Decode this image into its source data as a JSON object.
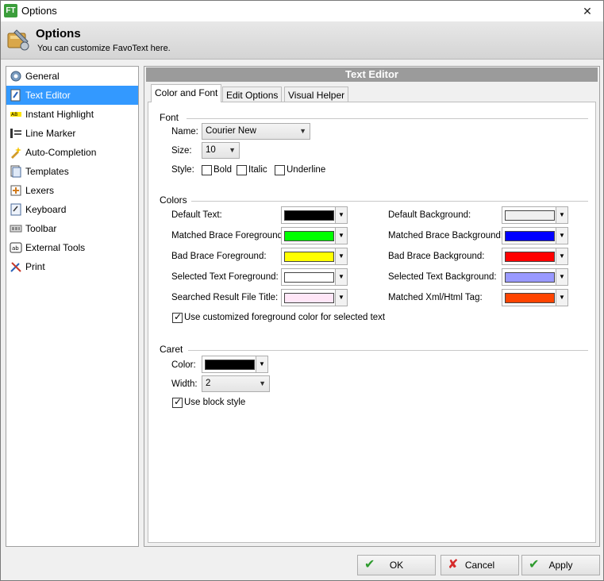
{
  "window": {
    "title": "Options",
    "app_badge": "FT",
    "close_glyph": "✕"
  },
  "header": {
    "title": "Options",
    "subtitle": "You can customize FavoText here."
  },
  "sidebar": {
    "items": [
      {
        "label": "General",
        "icon": "gear-icon"
      },
      {
        "label": "Text Editor",
        "icon": "text-editor-icon"
      },
      {
        "label": "Instant Highlight",
        "icon": "highlight-icon"
      },
      {
        "label": "Line Marker",
        "icon": "line-marker-icon"
      },
      {
        "label": "Auto-Completion",
        "icon": "auto-completion-icon"
      },
      {
        "label": "Templates",
        "icon": "templates-icon"
      },
      {
        "label": "Lexers",
        "icon": "lexers-icon"
      },
      {
        "label": "Keyboard",
        "icon": "keyboard-icon"
      },
      {
        "label": "Toolbar",
        "icon": "toolbar-icon"
      },
      {
        "label": "External Tools",
        "icon": "external-tools-icon"
      },
      {
        "label": "Print",
        "icon": "print-icon"
      }
    ],
    "selected": "Text Editor"
  },
  "panel": {
    "title": "Text Editor",
    "tabs": [
      "Color and Font",
      "Edit Options",
      "Visual Helper"
    ],
    "active_tab": "Color and Font"
  },
  "font": {
    "group": "Font",
    "name_label": "Name:",
    "name_value": "Courier New",
    "size_label": "Size:",
    "size_value": "10",
    "style_label": "Style:",
    "bold": "Bold",
    "italic": "Italic",
    "underline": "Underline",
    "bold_checked": false,
    "italic_checked": false,
    "underline_checked": false
  },
  "colors": {
    "group": "Colors",
    "left": [
      {
        "label": "Default Text:",
        "color": "#000000"
      },
      {
        "label": "Matched Brace Foreground:",
        "color": "#00ff00"
      },
      {
        "label": "Bad Brace Foreground:",
        "color": "#ffff00"
      },
      {
        "label": "Selected Text Foreground:",
        "color": "#ffffff"
      },
      {
        "label": "Searched Result File Title:",
        "color": "#ffe6f7"
      }
    ],
    "right": [
      {
        "label": "Default Background:",
        "color": "#f0f0f0"
      },
      {
        "label": "Matched Brace Background:",
        "color": "#0000ff"
      },
      {
        "label": "Bad Brace Background:",
        "color": "#ff0000"
      },
      {
        "label": "Selected Text Background:",
        "color": "#9999ff"
      },
      {
        "label": "Matched Xml/Html Tag:",
        "color": "#ff4400"
      }
    ],
    "use_custom_fg": "Use customized foreground color for selected text",
    "use_custom_fg_checked": true
  },
  "caret": {
    "group": "Caret",
    "color_label": "Color:",
    "color": "#000000",
    "width_label": "Width:",
    "width_value": "2",
    "block_style": "Use block style",
    "block_style_checked": true
  },
  "buttons": {
    "ok": "OK",
    "cancel": "Cancel",
    "apply": "Apply"
  }
}
